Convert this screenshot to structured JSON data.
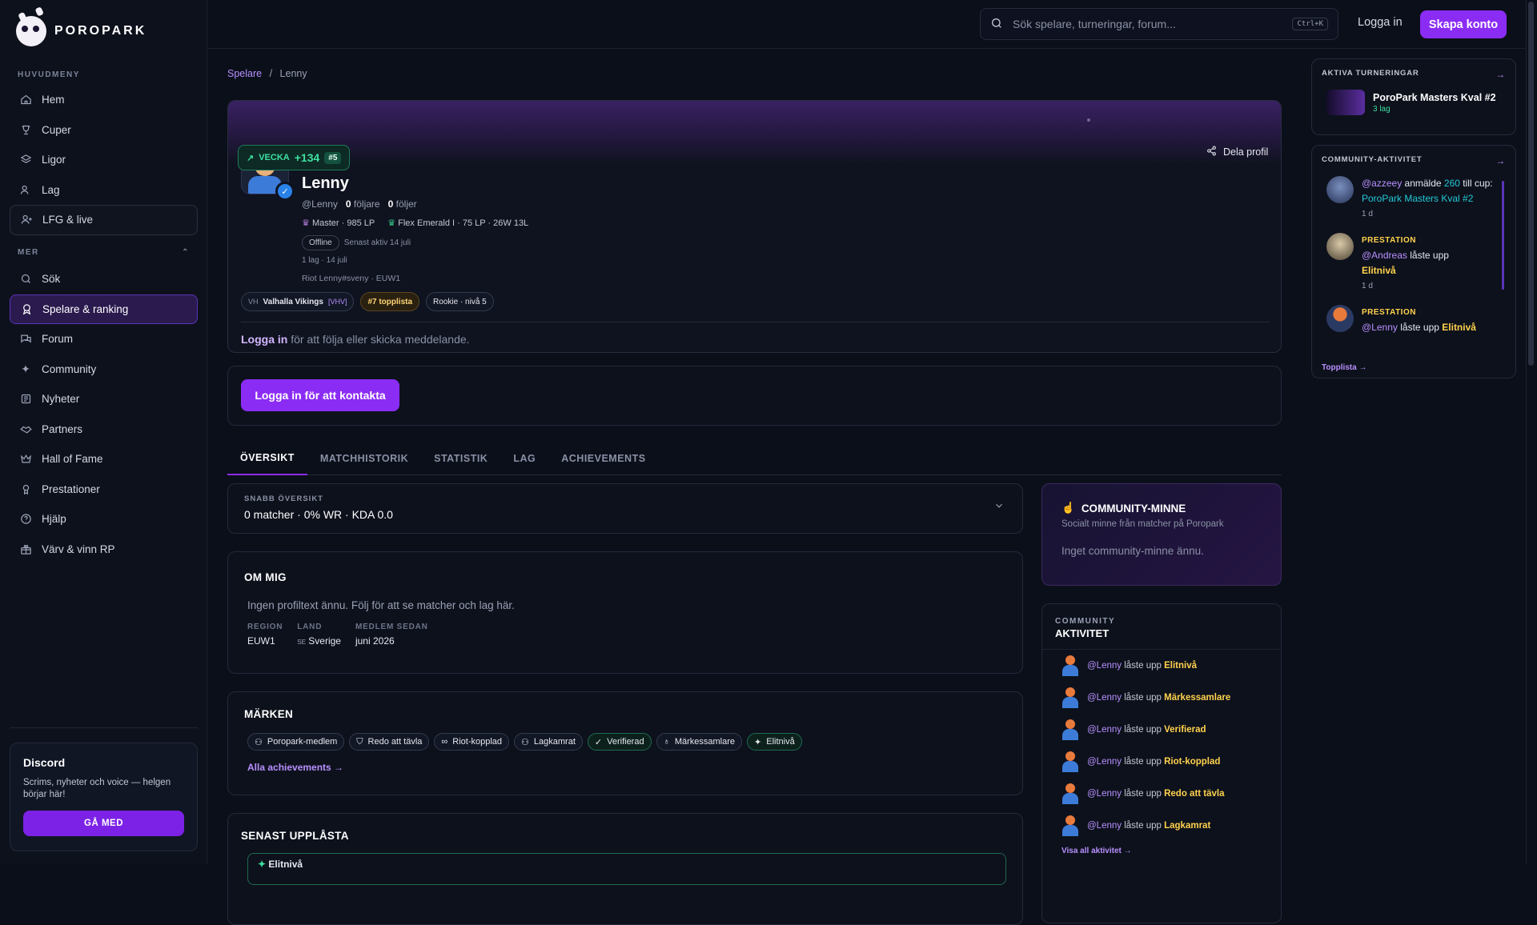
{
  "brand": {
    "name": "POROPARK"
  },
  "sidebar": {
    "main_label": "HUVUDMENY",
    "main_items": [
      {
        "label": "Hem",
        "icon": "home-icon"
      },
      {
        "label": "Cuper",
        "icon": "trophy-icon"
      },
      {
        "label": "Ligor",
        "icon": "layers-icon"
      },
      {
        "label": "Lag",
        "icon": "users-icon"
      },
      {
        "label": "LFG & live",
        "icon": "user-plus-icon"
      }
    ],
    "more_label": "MER",
    "more_items": [
      {
        "label": "Sök",
        "icon": "search-icon"
      },
      {
        "label": "Spelare & ranking",
        "icon": "award-icon"
      },
      {
        "label": "Forum",
        "icon": "forum-icon"
      },
      {
        "label": "Community",
        "icon": "sparkles-icon"
      },
      {
        "label": "Nyheter",
        "icon": "newspaper-icon"
      },
      {
        "label": "Partners",
        "icon": "handshake-icon"
      },
      {
        "label": "Hall of Fame",
        "icon": "crown-icon"
      },
      {
        "label": "Prestationer",
        "icon": "medal-icon"
      },
      {
        "label": "Hjälp",
        "icon": "help-icon"
      },
      {
        "label": "Värv & vinn RP",
        "icon": "gift-icon"
      }
    ],
    "discord": {
      "title": "Discord",
      "text": "Scrims, nyheter och voice — helgen börjar här!",
      "button": "GÅ MED"
    }
  },
  "topbar": {
    "search_placeholder": "Sök spelare, turneringar, forum...",
    "shortcut": "Ctrl+K",
    "login": "Logga in",
    "create": "Skapa konto"
  },
  "breadcrumb": {
    "parent": "Spelare",
    "sep": "/",
    "current": "Lenny"
  },
  "profile": {
    "week_label": "VECKA",
    "week_points": "+134",
    "week_rank": "#5",
    "name": "Lenny",
    "handle": "@Lenny",
    "followers_count": "0",
    "followers_label": "följare",
    "following_count": "0",
    "following_label": "följer",
    "rank1": "Master · 985 LP",
    "rank2": "Flex Emerald I · 75 LP · 26W 13L",
    "status": "Offline",
    "last_active": "Senast aktiv 14 juli",
    "teams_info": "1 lag · 14 juli",
    "riot": "Riot Lenny#sveny · EUW1",
    "team_abbr": "VH",
    "team_name": "Valhalla Vikings",
    "team_tag": "[VHV]",
    "top_chip": "#7 topplista",
    "rookie_chip": "Rookie · nivå 5",
    "login_prompt_link": "Logga in",
    "login_prompt_text": " för att följa eller skicka meddelande.",
    "share": "Dela profil",
    "contact_button": "Logga in för att kontakta"
  },
  "tabs": [
    "ÖVERSIKT",
    "MATCHHISTORIK",
    "STATISTIK",
    "LAG",
    "ACHIEVEMENTS"
  ],
  "snabb": {
    "label": "SNABB ÖVERSIKT",
    "value": "0 matcher · 0% WR · KDA 0.0"
  },
  "about": {
    "title": "OM MIG",
    "text": "Ingen profiltext ännu. Följ för att se matcher och lag här.",
    "region_k": "REGION",
    "region_v": "EUW1",
    "land_k": "LAND",
    "land_flag": "SE",
    "land_v": "Sverige",
    "since_k": "MEDLEM SEDAN",
    "since_v": "juni 2026"
  },
  "marks": {
    "title": "MÄRKEN",
    "items": [
      {
        "label": "Poropark-medlem",
        "icon": "user-icon"
      },
      {
        "label": "Redo att tävla",
        "icon": "shield-icon"
      },
      {
        "label": "Riot-kopplad",
        "icon": "link-icon"
      },
      {
        "label": "Lagkamrat",
        "icon": "users-icon"
      },
      {
        "label": "Verifierad",
        "icon": "check-icon"
      },
      {
        "label": "Märkessamlare",
        "icon": "medal-icon"
      },
      {
        "label": "Elitnivå",
        "icon": "sparkles-icon"
      }
    ],
    "all_link": "Alla achievements →"
  },
  "recent": {
    "title": "SENAST UPPLÅSTA",
    "first": "Elitnivå"
  },
  "minne": {
    "title": "COMMUNITY-MINNE",
    "sub": "Socialt minne från matcher på Poropark",
    "empty": "Inget community-minne ännu."
  },
  "activity": {
    "l1": "COMMUNITY",
    "l2": "AKTIVITET",
    "verb": "låste upp",
    "user": "@Lenny",
    "items": [
      "Elitnivå",
      "Märkessamlare",
      "Verifierad",
      "Riot-kopplad",
      "Redo att tävla",
      "Lagkamrat"
    ],
    "more": "Visa all aktivitet →"
  },
  "right": {
    "tournaments_label": "AKTIVA TURNERINGAR",
    "tournament_name": "PoroPark Masters Kval #2",
    "tournament_teams": "3 lag",
    "community_label": "COMMUNITY-AKTIVITET",
    "ca1_user": "@azzeey",
    "ca1_text": " anmälde ",
    "ca1_num": "260",
    "ca1_text2": " till cup: ",
    "ca1_target": "PoroPark Masters Kval #2",
    "ca1_time": "1 d",
    "ca2_label": "PRESTATION",
    "ca2_user": "@Andreas",
    "ca2_text": " låste upp ",
    "ca2_target": "Elitnivå",
    "ca2_time": "1 d",
    "ca3_label": "PRESTATION",
    "ca3_user": "@Lenny",
    "ca3_text": " låste upp ",
    "ca3_target": "Elitnivå",
    "toplist_link": "Topplista →"
  },
  "colors": {
    "accent": "#8b2cf5",
    "bg": "#0b0f1a",
    "gold": "#ffd24d",
    "green": "#3ee0a0"
  }
}
